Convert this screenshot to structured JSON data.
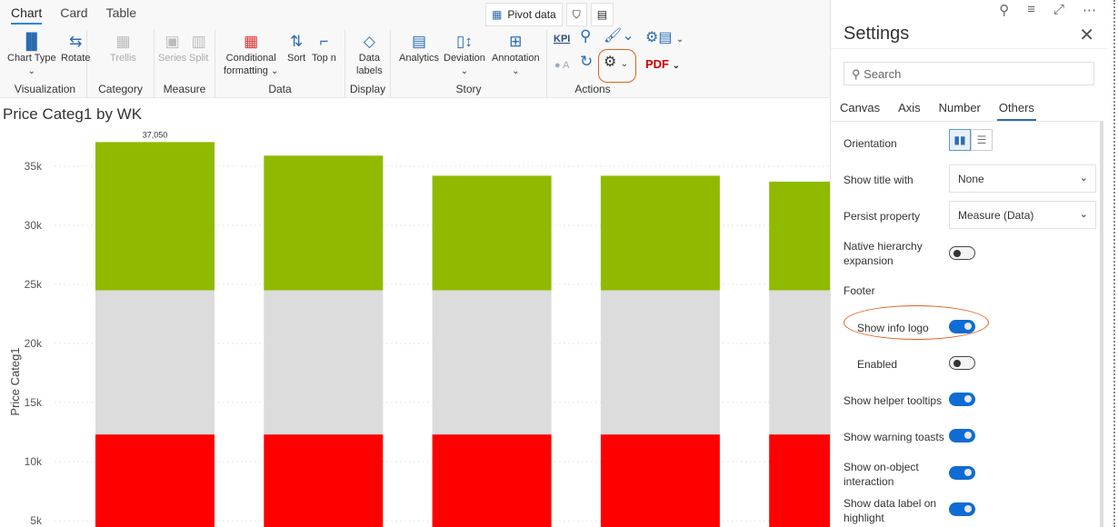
{
  "ribbon": {
    "tabs": [
      "Chart",
      "Card",
      "Table"
    ],
    "top_buttons": {
      "pivot": "Pivot data"
    },
    "groups": {
      "visualization": "Visualization",
      "category": "Category",
      "measure": "Measure",
      "data": "Data",
      "display": "Display",
      "story": "Story",
      "actions": "Actions"
    },
    "buttons": {
      "chart_type": "Chart Type",
      "rotate": "Rotate",
      "trellis": "Trellis",
      "series": "Series",
      "split": "Split",
      "conditional": "Conditional",
      "formatting": "formatting",
      "sort": "Sort",
      "topn": "Top n",
      "data": "Data",
      "labels": "labels",
      "analytics": "Analytics",
      "deviation": "Deviation",
      "annotation": "Annotation",
      "kpi": "KPI",
      "oa": "A"
    }
  },
  "chart_data": {
    "type": "bar",
    "stacked": true,
    "title": "Price Categ1 by WK",
    "ylabel": "Price Categ1",
    "ylim": [
      0,
      38000
    ],
    "yticks": [
      5000,
      10000,
      15000,
      20000,
      25000,
      30000,
      35000
    ],
    "ytick_labels": [
      "5k",
      "10k",
      "15k",
      "20k",
      "25k",
      "30k",
      "35k"
    ],
    "series": [
      {
        "color": "#ff0000",
        "values": [
          12300,
          12300,
          12300,
          12300,
          12300
        ]
      },
      {
        "color": "#dcdcdc",
        "values": [
          12200,
          12200,
          12200,
          12200,
          12200
        ]
      },
      {
        "color": "#8fba00",
        "values": [
          12550,
          11400,
          9700,
          9700,
          9200
        ]
      }
    ],
    "totals": [
      37050,
      35900,
      34200,
      34200,
      33700
    ],
    "data_labels": [
      "37,050"
    ]
  },
  "settings": {
    "title": "Settings",
    "search_placeholder": "Search",
    "tabs": [
      "Canvas",
      "Axis",
      "Number",
      "Others"
    ],
    "active_tab": "Others",
    "orientation": "Orientation",
    "show_title_with": {
      "label": "Show title with",
      "value": "None"
    },
    "persist_property": {
      "label": "Persist property",
      "value": "Measure (Data)"
    },
    "native_hierarchy": {
      "label1": "Native hierarchy",
      "label2": "expansion",
      "on": false
    },
    "footer": "Footer",
    "show_info_logo": {
      "label": "Show info logo",
      "on": true
    },
    "enabled": {
      "label": "Enabled",
      "on": false
    },
    "helper_tooltips": {
      "label": "Show helper tooltips",
      "on": true
    },
    "warning_toasts": {
      "label": "Show warning toasts",
      "on": true
    },
    "on_object": {
      "label1": "Show on-object",
      "label2": "interaction",
      "on": true
    },
    "data_label_highlight": {
      "label1": "Show data label on",
      "label2": "highlight",
      "on": true
    }
  }
}
